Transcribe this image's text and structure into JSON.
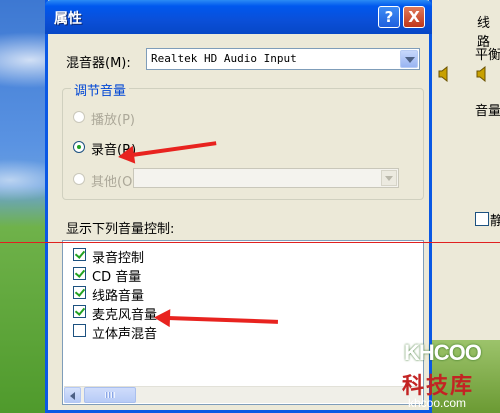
{
  "dialog": {
    "title": "属性",
    "help_button": "?",
    "close_button": "X",
    "mixer_label": "混音器(M):",
    "mixer_value": "Realtek HD Audio Input",
    "volume_group_title": "调节音量",
    "radio_options": [
      {
        "label": "播放(P)",
        "checked": false,
        "disabled": true
      },
      {
        "label": "录音(R)",
        "checked": true,
        "disabled": false
      },
      {
        "label": "其他(O)",
        "checked": false,
        "disabled": true
      }
    ],
    "show_controls_label": "显示下列音量控制:",
    "controls": [
      {
        "label": "录音控制",
        "checked": true
      },
      {
        "label": "CD 音量",
        "checked": true
      },
      {
        "label": "线路音量",
        "checked": true
      },
      {
        "label": "麦克风音量",
        "checked": true
      },
      {
        "label": "立体声混音",
        "checked": false
      }
    ]
  },
  "background_window": {
    "title_fragment": "线路",
    "balance_fragment": "平衡",
    "volume_fragment": "音量",
    "checkbox_fragment": "静"
  },
  "watermark": {
    "brand": "KHCOO",
    "name": "科技库",
    "url": "khcoo.com"
  },
  "colors": {
    "titlebar": "#0a4fd8",
    "annotation_red": "#e8231f",
    "group_title_blue": "#0046d5"
  }
}
